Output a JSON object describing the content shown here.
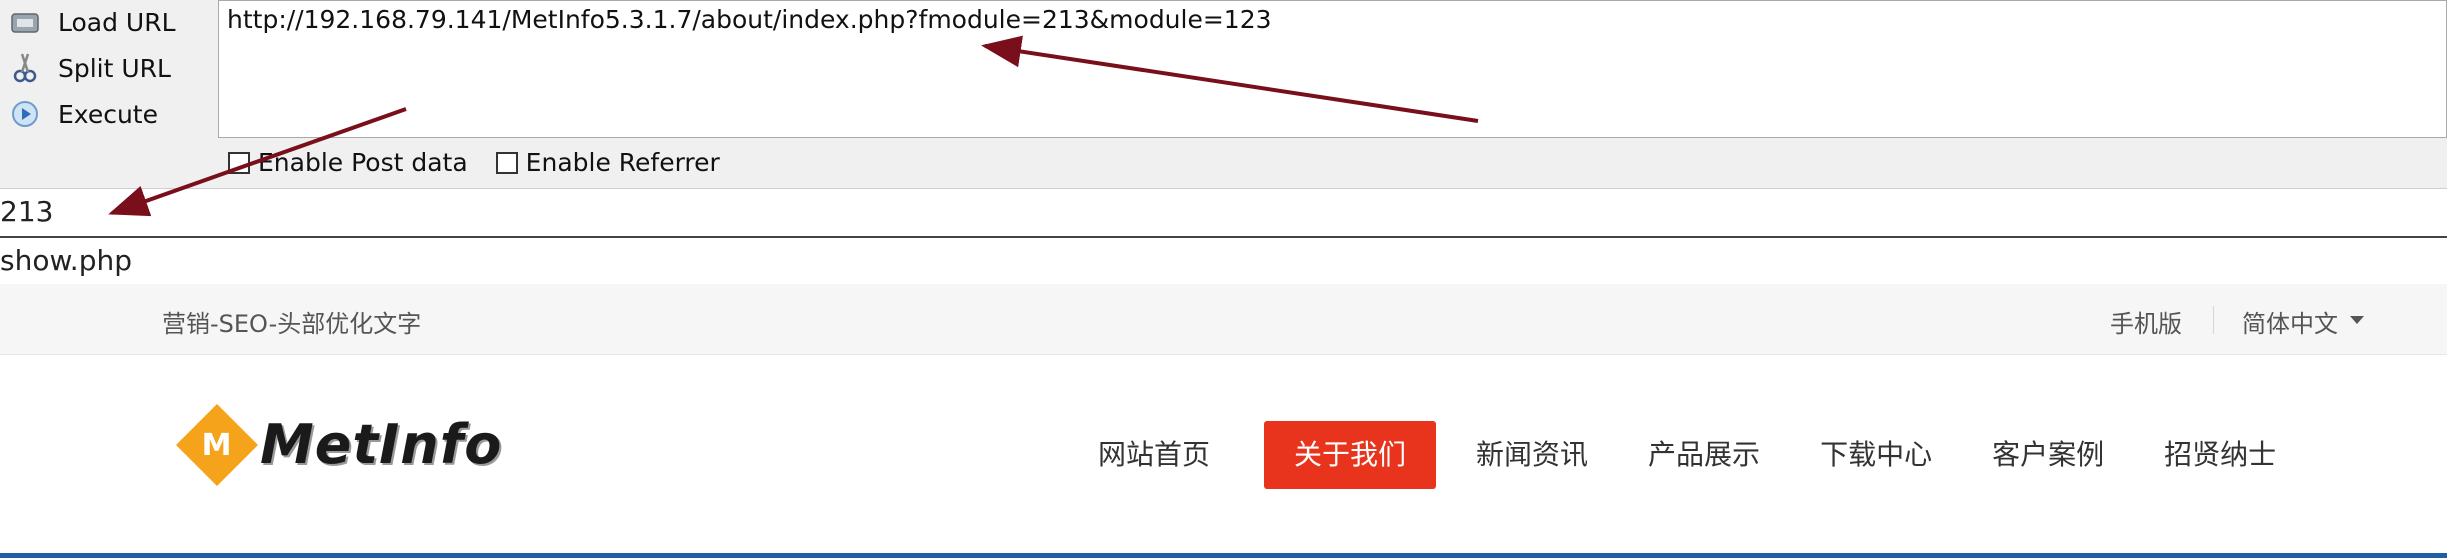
{
  "hackbar": {
    "buttons": [
      {
        "label": "Load URL",
        "icon": "load-url-icon"
      },
      {
        "label": "Split URL",
        "icon": "split-url-icon"
      },
      {
        "label": "Execute",
        "icon": "execute-icon"
      }
    ],
    "url": "http://192.168.79.141/MetInfo5.3.1.7/about/index.php?fmodule=213&module=123",
    "options": {
      "post_label": "Enable Post data",
      "referrer_label": "Enable Referrer"
    }
  },
  "echo": {
    "line1": "213",
    "line2": "show.php"
  },
  "site": {
    "topbar": {
      "slogan": "营销-SEO-头部优化文字",
      "mobile": "手机版",
      "language": "简体中文"
    },
    "logo_letter": "M",
    "logo_text": "MetInfo",
    "nav": [
      "网站首页",
      "关于我们",
      "新闻资讯",
      "产品展示",
      "下载中心",
      "客户案例",
      "招贤纳士"
    ],
    "active_nav": "关于我们",
    "colors": {
      "accent": "#e8341c",
      "logo": "#f5a31a",
      "annotation": "#7a0f1c"
    }
  }
}
